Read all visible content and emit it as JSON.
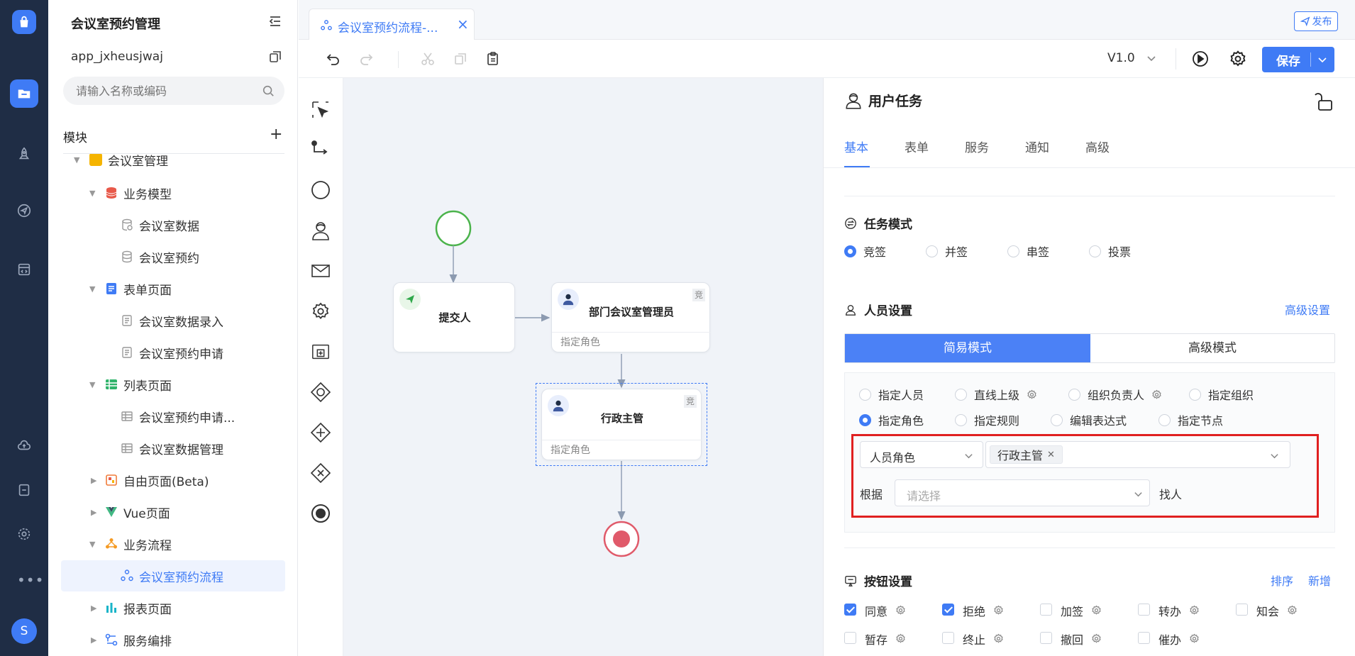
{
  "sidebar": {
    "app_title": "会议室预约管理",
    "app_id": "app_jxheusjwaj",
    "search_placeholder": "请输入名称或编码",
    "module_label": "模块",
    "tree": [
      {
        "label": "会议室管理"
      },
      {
        "label": "业务模型"
      },
      {
        "label": "会议室数据"
      },
      {
        "label": "会议室预约"
      },
      {
        "label": "表单页面"
      },
      {
        "label": "会议室数据录入"
      },
      {
        "label": "会议室预约申请"
      },
      {
        "label": "列表页面"
      },
      {
        "label": "会议室预约申请..."
      },
      {
        "label": "会议室数据管理"
      },
      {
        "label": "自由页面(Beta)"
      },
      {
        "label": "Vue页面"
      },
      {
        "label": "业务流程"
      },
      {
        "label": "会议室预约流程"
      },
      {
        "label": "报表页面"
      },
      {
        "label": "服务编排"
      }
    ]
  },
  "rail": {
    "avatar_letter": "S"
  },
  "tab": {
    "label": "会议室预约流程-..."
  },
  "publish_label": "发布",
  "toolbar": {
    "version": "V1.0",
    "save_label": "保存"
  },
  "canvas": {
    "nodes": [
      {
        "title": "提交人"
      },
      {
        "title": "部门会议室管理员",
        "sub": "指定角色",
        "badge": "竞"
      },
      {
        "title": "行政主管",
        "sub": "指定角色",
        "badge": "竞"
      }
    ]
  },
  "panel": {
    "title": "用户任务",
    "tabs": [
      "基本",
      "表单",
      "服务",
      "通知",
      "高级"
    ],
    "task_mode": {
      "title": "任务模式",
      "options": [
        "竞签",
        "并签",
        "串签",
        "投票"
      ],
      "selected": 0
    },
    "people": {
      "title": "人员设置",
      "advanced_link": "高级设置",
      "modes": [
        "简易模式",
        "高级模式"
      ],
      "options_row1": [
        "指定人员",
        "直线上级",
        "组织负责人",
        "指定组织"
      ],
      "options_row2": [
        "指定角色",
        "指定规则",
        "编辑表达式",
        "指定节点"
      ],
      "role_type": "人员角色",
      "role_tag": "行政主管",
      "by_label": "根据",
      "by_placeholder": "请选择",
      "find_label": "找人"
    },
    "buttons": {
      "title": "按钮设置",
      "sort_link": "排序",
      "add_link": "新增",
      "row1": [
        {
          "label": "同意",
          "checked": true
        },
        {
          "label": "拒绝",
          "checked": true
        },
        {
          "label": "加签",
          "checked": false
        },
        {
          "label": "转办",
          "checked": false
        },
        {
          "label": "知会",
          "checked": false
        }
      ],
      "row2": [
        {
          "label": "暂存",
          "checked": false
        },
        {
          "label": "终止",
          "checked": false
        },
        {
          "label": "撤回",
          "checked": false
        },
        {
          "label": "催办",
          "checked": false
        }
      ]
    }
  },
  "colors": {
    "accent": "#3f7bf5",
    "rail": "#1f2d45",
    "highlight": "#e02020"
  }
}
